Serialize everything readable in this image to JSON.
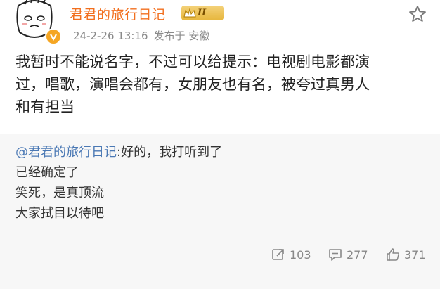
{
  "post": {
    "username": "君君的旅行日记",
    "level": "II",
    "date": "24-2-26 13:16",
    "location": "发布于 安徽",
    "content_lines": [
      "我暂时不能说名字，不过可以给提示：电视剧电影都演",
      "过，唱歌，演唱会都有，女朋友也有名，被夸过真男人",
      "和有担当"
    ]
  },
  "quote": {
    "mention": "@君君的旅行日记",
    "first_line_rest": ":好的，我打听到了",
    "lines": [
      "已经确定了",
      "笑死，是真顶流",
      "大家拭目以待吧"
    ]
  },
  "actions": {
    "repost_count": "103",
    "comment_count": "277",
    "like_count": "371"
  },
  "icons": {
    "avatar": "cartoon-face-avatar",
    "verify": "verified-v-icon",
    "level": "crown-level-icon",
    "favorite": "star-icon",
    "repost": "repost-icon",
    "comment": "comment-icon",
    "like": "thumbs-up-icon"
  },
  "colors": {
    "username": "#f26f1e",
    "mention": "#4a78b4",
    "verify": "#f5a623",
    "background": "#f7f7f7"
  }
}
